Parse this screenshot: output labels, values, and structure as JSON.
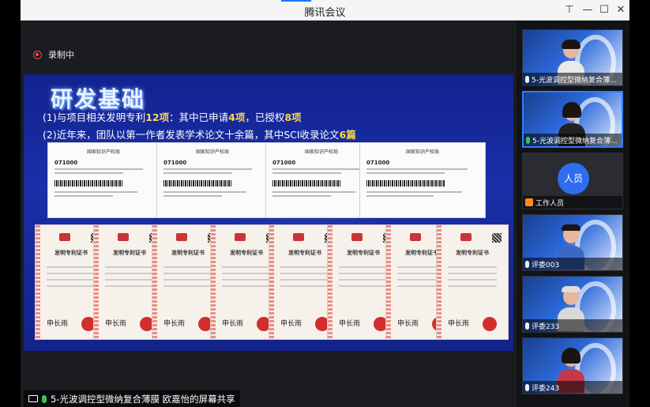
{
  "window": {
    "title": "腾讯会议",
    "minimize": "—",
    "maximize": "☐",
    "close": "✕",
    "pin": "⊤"
  },
  "recording": {
    "label": "录制中"
  },
  "slide": {
    "title": "研发基础",
    "bullet1": {
      "prefix": "(1)与项目相关发明专利",
      "n1": "12项",
      "mid1": "：其中已申请",
      "n2": "4项",
      "mid2": "，已授权",
      "n3": "8项"
    },
    "bullet2": {
      "prefix": "(2)近年来，团队以第一作者发表学术论文十余篇，其中SCI收录论文",
      "n1": "6篇"
    },
    "certs": [
      {
        "header": "国家知识产权局",
        "number": "071000"
      },
      {
        "header": "国家知识产权局",
        "number": "071000"
      },
      {
        "header": "国家知识产权局",
        "number": "071000"
      },
      {
        "header": "国家知识产权局",
        "number": "071000"
      }
    ],
    "books": [
      {
        "title": "发明专利证书",
        "sig": "申长雨"
      },
      {
        "title": "发明专利证书",
        "sig": "申长雨"
      },
      {
        "title": "发明专利证书",
        "sig": "申长雨"
      },
      {
        "title": "发明专利证书",
        "sig": "申长雨"
      },
      {
        "title": "发明专利证书",
        "sig": "申长雨"
      },
      {
        "title": "发明专利证书",
        "sig": "申长雨"
      },
      {
        "title": "发明专利证书",
        "sig": "申长雨"
      },
      {
        "title": "发明专利证书",
        "sig": "申长雨"
      }
    ]
  },
  "share_bar": {
    "text": "5-光波调控型微纳复合薄膜  欧嘉怡的屏幕共享"
  },
  "participants": [
    {
      "name": "5-光波调控型微纳复合薄...",
      "mic": "muted",
      "kind": "video"
    },
    {
      "name": "5-光波调控型微纳复合薄...",
      "mic": "speaking",
      "kind": "video"
    },
    {
      "name": "工作人员",
      "avatar": "人员",
      "kind": "staff"
    },
    {
      "name": "评委003",
      "mic": "muted",
      "kind": "video"
    },
    {
      "name": "评委233",
      "mic": "muted",
      "kind": "video"
    },
    {
      "name": "评委243",
      "mic": "muted",
      "kind": "video"
    }
  ],
  "colors": {
    "accent": "#1677ff",
    "recording": "#f24a4a",
    "highlight": "#ffd84a",
    "speaking": "#31c85a"
  }
}
